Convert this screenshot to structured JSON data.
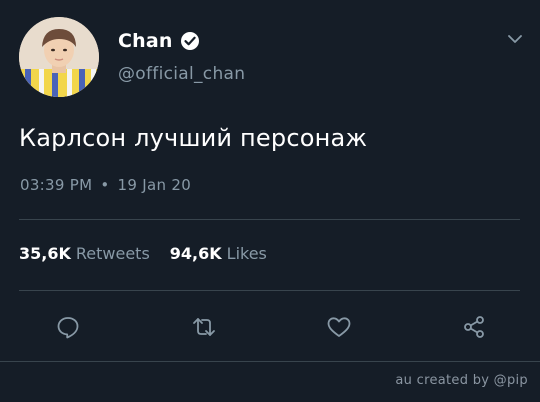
{
  "tweet": {
    "display_name": "Chan",
    "username": "@official_chan",
    "text": "Карлсон лучший персонаж",
    "time": "03:39 PM",
    "separator": "•",
    "date": "19 Jan 20",
    "retweets": "35,6K",
    "retweets_label": "Retweets",
    "likes": "94,6K",
    "likes_label": "Likes"
  },
  "icons": {
    "verified": "verified-badge-icon",
    "caret": "chevron-down-icon",
    "reply": "reply-icon",
    "retweet": "retweet-icon",
    "like": "heart-icon",
    "share": "share-icon"
  },
  "colors": {
    "background": "#151d27",
    "text": "#ffffff",
    "secondary": "#8899a6",
    "divider": "#38444d"
  },
  "watermark": "au created by @pip"
}
